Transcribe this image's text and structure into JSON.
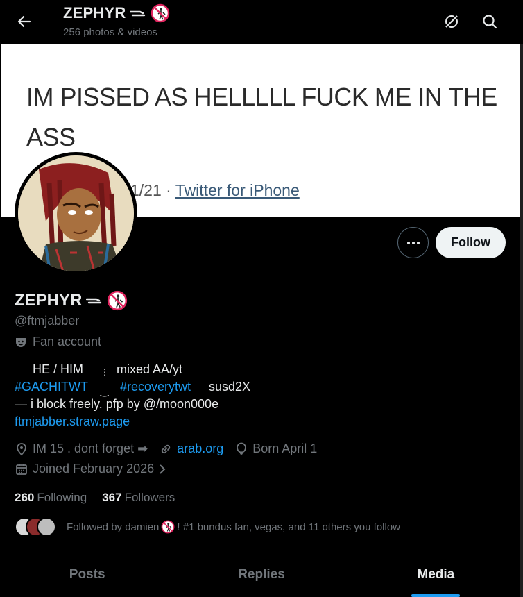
{
  "header": {
    "name": "ZEPHYR",
    "subtitle": "256 photos & videos"
  },
  "banner": {
    "text": "IM PISSED AS HELLLLL FUCK ME IN THE ASS",
    "meta_date": "1/21 · ",
    "meta_source": "Twitter for iPhone"
  },
  "actions": {
    "more_label": "···",
    "follow_label": "Follow"
  },
  "profile": {
    "name": "ZEPHYR",
    "handle": "@ftmjabber",
    "category": "Fan account",
    "bio": {
      "line1_a": "HE / HIM",
      "line1_b": "mixed AA/yt",
      "hashtag1": "#GACHITWT",
      "hashtag2": "#recoverytwt",
      "line2_c": "susd2X",
      "line3": "— i block freely. pfp by @/moon000e",
      "link": "ftmjabber.straw.page"
    },
    "location": "IM 15 . dont forget ➡",
    "website": "arab.org",
    "birthday": "Born April 1",
    "joined": "Joined February 2026",
    "following_count": "260",
    "following_label": "Following",
    "followers_count": "367",
    "followers_label": "Followers",
    "followed_by_a": "Followed by damien",
    "followed_by_b": "! #1 bundus fan, vegas, and 11 others you follow"
  },
  "tabs": [
    {
      "label": "Posts"
    },
    {
      "label": "Replies"
    },
    {
      "label": "Media"
    }
  ],
  "colors": {
    "background": "#000000",
    "accent": "#1d9bf0",
    "muted": "#71767b",
    "text": "#e7e9ea"
  }
}
